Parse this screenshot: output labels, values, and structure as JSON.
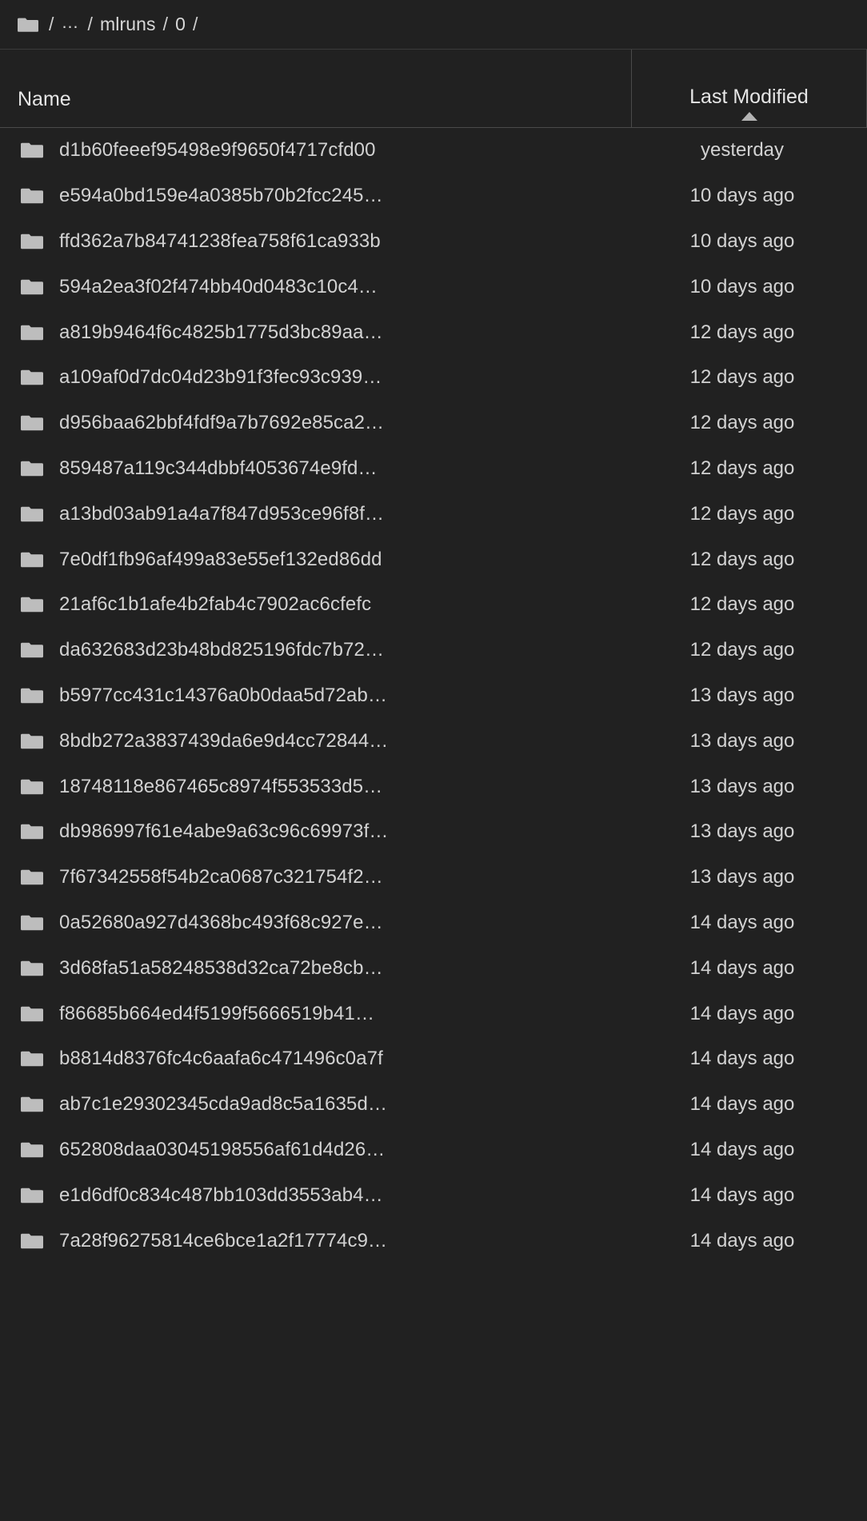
{
  "breadcrumb": {
    "folder_icon": "folder-icon",
    "segments": [
      "/",
      "…",
      "/",
      "mlruns",
      "/",
      "0",
      "/"
    ]
  },
  "columns": {
    "name": "Name",
    "last_modified": "Last Modified",
    "sort_icon": "caret-up-icon",
    "sort_direction": "ascending"
  },
  "colors": {
    "background": "#212121",
    "text": "#d2d2d2",
    "border": "#4a4a4a",
    "folder": "#bdbdbd"
  },
  "rows": [
    {
      "name": "d1b60feeef95498e9f9650f4717cfd00",
      "modified": "yesterday"
    },
    {
      "name": "e594a0bd159e4a0385b70b2fcc245…",
      "modified": "10 days ago"
    },
    {
      "name": "ffd362a7b84741238fea758f61ca933b",
      "modified": "10 days ago"
    },
    {
      "name": "594a2ea3f02f474bb40d0483c10c4…",
      "modified": "10 days ago"
    },
    {
      "name": "a819b9464f6c4825b1775d3bc89aa…",
      "modified": "12 days ago"
    },
    {
      "name": "a109af0d7dc04d23b91f3fec93c939…",
      "modified": "12 days ago"
    },
    {
      "name": "d956baa62bbf4fdf9a7b7692e85ca2…",
      "modified": "12 days ago"
    },
    {
      "name": "859487a119c344dbbf4053674e9fd…",
      "modified": "12 days ago"
    },
    {
      "name": "a13bd03ab91a4a7f847d953ce96f8f…",
      "modified": "12 days ago"
    },
    {
      "name": "7e0df1fb96af499a83e55ef132ed86dd",
      "modified": "12 days ago"
    },
    {
      "name": "21af6c1b1afe4b2fab4c7902ac6cfefc",
      "modified": "12 days ago"
    },
    {
      "name": "da632683d23b48bd825196fdc7b72…",
      "modified": "12 days ago"
    },
    {
      "name": "b5977cc431c14376a0b0daa5d72ab…",
      "modified": "13 days ago"
    },
    {
      "name": "8bdb272a3837439da6e9d4cc72844…",
      "modified": "13 days ago"
    },
    {
      "name": "18748118e867465c8974f553533d5…",
      "modified": "13 days ago"
    },
    {
      "name": "db986997f61e4abe9a63c96c69973f…",
      "modified": "13 days ago"
    },
    {
      "name": "7f67342558f54b2ca0687c321754f2…",
      "modified": "13 days ago"
    },
    {
      "name": "0a52680a927d4368bc493f68c927e…",
      "modified": "14 days ago"
    },
    {
      "name": "3d68fa51a58248538d32ca72be8cb…",
      "modified": "14 days ago"
    },
    {
      "name": "f86685b664ed4f5199f5666519b41…",
      "modified": "14 days ago"
    },
    {
      "name": "b8814d8376fc4c6aafa6c471496c0a7f",
      "modified": "14 days ago"
    },
    {
      "name": "ab7c1e29302345cda9ad8c5a1635d…",
      "modified": "14 days ago"
    },
    {
      "name": "652808daa03045198556af61d4d26…",
      "modified": "14 days ago"
    },
    {
      "name": "e1d6df0c834c487bb103dd3553ab4…",
      "modified": "14 days ago"
    },
    {
      "name": "7a28f96275814ce6bce1a2f17774c9…",
      "modified": "14 days ago"
    }
  ]
}
